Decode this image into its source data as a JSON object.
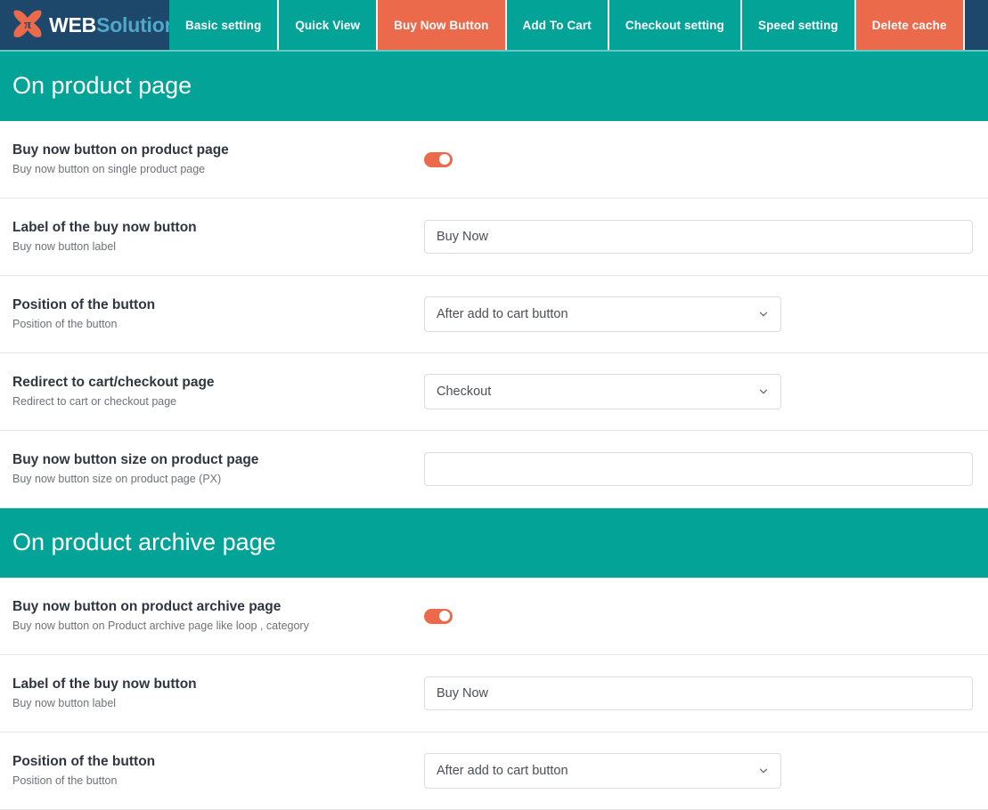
{
  "brand": {
    "logo_icon": "x-pi-logo-icon",
    "name_primary": "WEB",
    "name_secondary": "Solution"
  },
  "nav": {
    "items": [
      {
        "label": "Basic setting",
        "state": "default"
      },
      {
        "label": "Quick View",
        "state": "default"
      },
      {
        "label": "Buy Now Button",
        "state": "active"
      },
      {
        "label": "Add To Cart",
        "state": "default"
      },
      {
        "label": "Checkout setting",
        "state": "default"
      },
      {
        "label": "Speed setting",
        "state": "default"
      },
      {
        "label": "Delete cache",
        "state": "danger"
      }
    ]
  },
  "colors": {
    "teal": "#04a398",
    "orange": "#ec6a4c",
    "navy": "#1d486b",
    "border": "#dcdcdc",
    "divider": "#e7e7e7"
  },
  "sections": [
    {
      "title": "On product page",
      "rows": [
        {
          "title": "Buy now button on product page",
          "desc": "Buy now button on single product page",
          "control": "toggle",
          "value": "on"
        },
        {
          "title": "Label of the buy now button",
          "desc": "Buy now button label",
          "control": "text",
          "value": "Buy Now",
          "placeholder": ""
        },
        {
          "title": "Position of the button",
          "desc": "Position of the button",
          "control": "select",
          "value": "After add to cart button"
        },
        {
          "title": "Redirect to cart/checkout page",
          "desc": "Redirect to cart or checkout page",
          "control": "select",
          "value": "Checkout"
        },
        {
          "title": "Buy now button size on product page",
          "desc": "Buy now button size on product page (PX)",
          "control": "text",
          "value": "",
          "placeholder": ""
        }
      ]
    },
    {
      "title": "On product archive page",
      "rows": [
        {
          "title": "Buy now button on product archive page",
          "desc": "Buy now button on Product archive page like loop , category",
          "control": "toggle",
          "value": "on"
        },
        {
          "title": "Label of the buy now button",
          "desc": "Buy now button label",
          "control": "text",
          "value": "Buy Now",
          "placeholder": ""
        },
        {
          "title": "Position of the button",
          "desc": "Position of the button",
          "control": "select",
          "value": "After add to cart button"
        }
      ]
    }
  ]
}
